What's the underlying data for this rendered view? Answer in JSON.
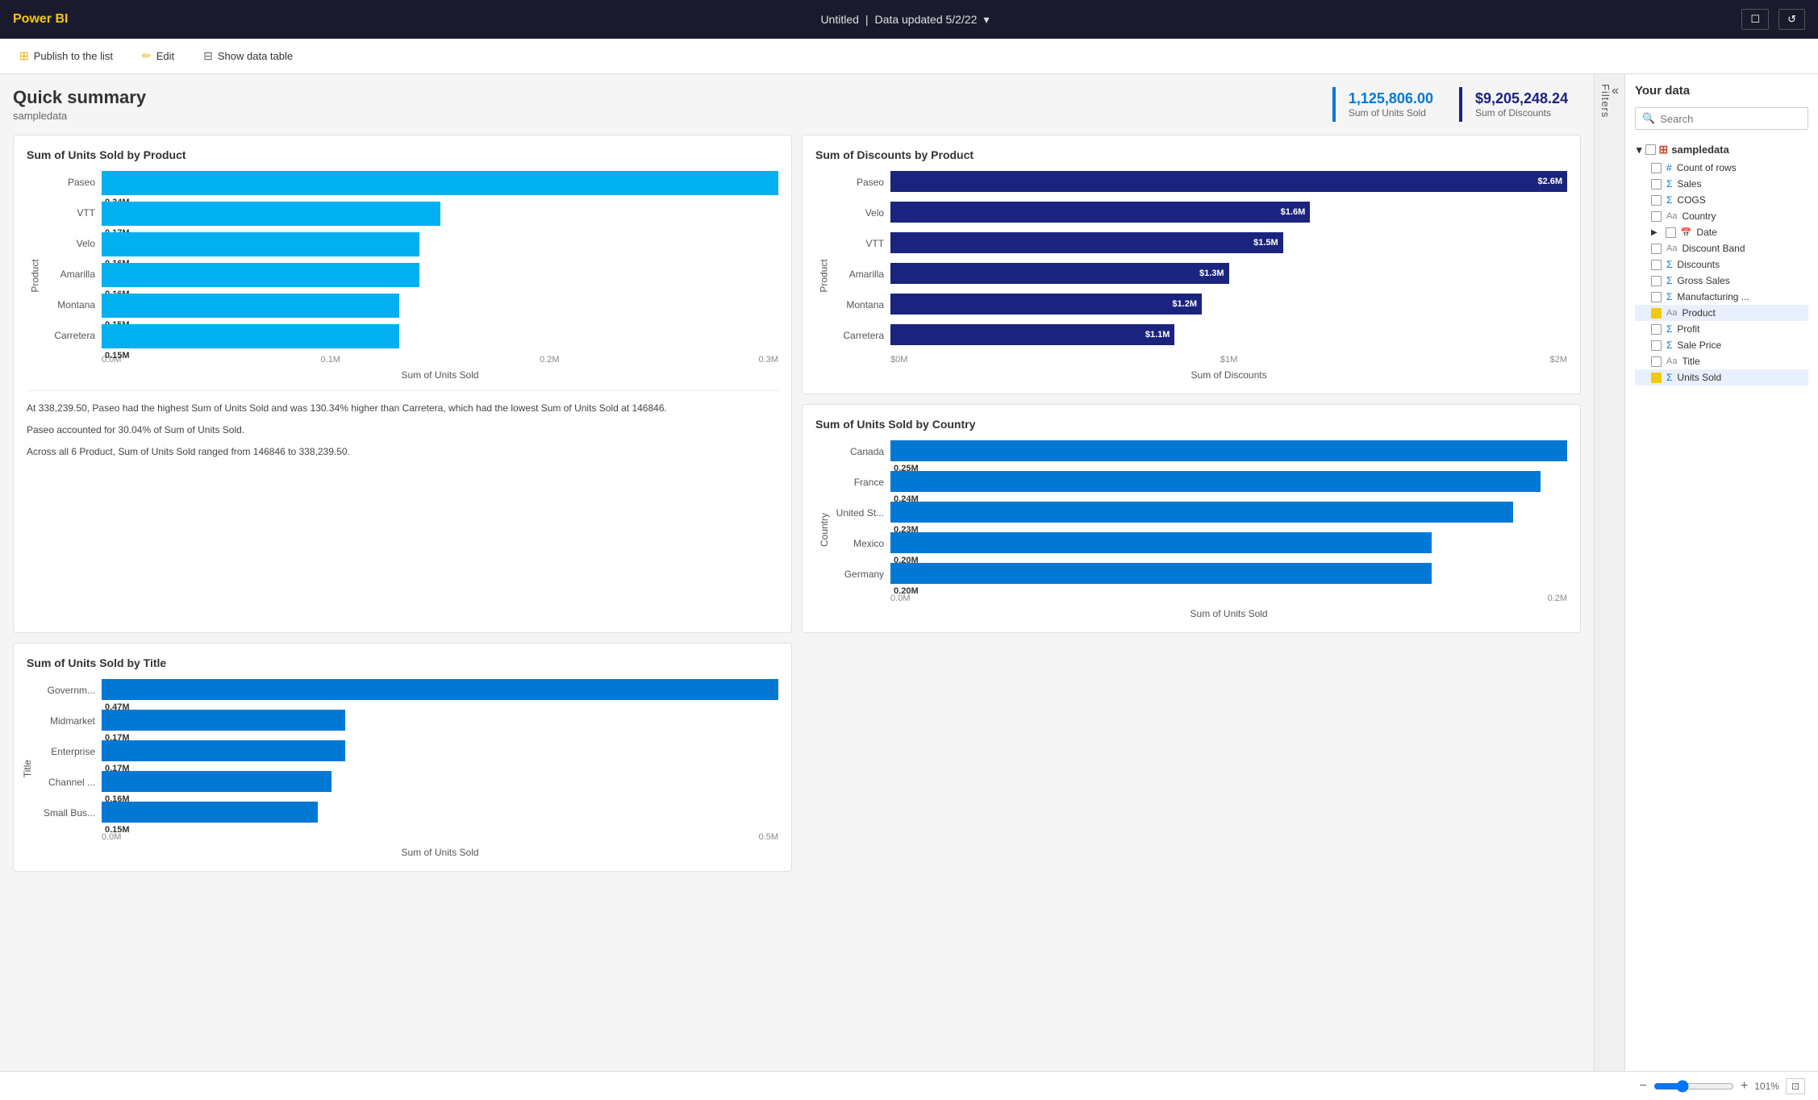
{
  "topbar": {
    "logo": "Power BI",
    "title": "Untitled",
    "separator": "|",
    "data_updated": "Data updated 5/2/22",
    "chevron": "▾",
    "btn_window": "☐",
    "btn_refresh": "↺"
  },
  "secondbar": {
    "publish": "Publish to the list",
    "edit": "Edit",
    "show_data_table": "Show data table"
  },
  "header": {
    "title": "Quick summary",
    "subtitle": "sampledata",
    "kpi1_value": "1,125,806.00",
    "kpi1_label": "Sum of Units Sold",
    "kpi2_value": "$9,205,248.24",
    "kpi2_label": "Sum of Discounts"
  },
  "chart1": {
    "title": "Sum of Units Sold by Product",
    "bars": [
      {
        "label": "Paseo",
        "value": "0.34M",
        "pct": 100
      },
      {
        "label": "VTT",
        "value": "0.17M",
        "pct": 50
      },
      {
        "label": "Velo",
        "value": "0.16M",
        "pct": 47
      },
      {
        "label": "Amarilla",
        "value": "0.16M",
        "pct": 47
      },
      {
        "label": "Montana",
        "value": "0.15M",
        "pct": 44
      },
      {
        "label": "Carretera",
        "value": "0.15M",
        "pct": 44
      }
    ],
    "x_ticks": [
      "0.0M",
      "0.1M",
      "0.2M",
      "0.3M"
    ],
    "x_label": "Sum of Units Sold",
    "y_label": "Product",
    "insight1": "At 338,239.50, Paseo had the highest Sum of Units Sold and was 130.34% higher than Carretera, which had the lowest Sum of Units Sold at 146846.",
    "insight2": "Paseo accounted for 30.04% of Sum of Units Sold.",
    "insight3": "Across all 6 Product, Sum of Units Sold ranged from 146846 to 338,239.50."
  },
  "chart2": {
    "title": "Sum of Discounts by Product",
    "bars": [
      {
        "label": "Paseo",
        "value": "$2.6M",
        "pct": 100
      },
      {
        "label": "Velo",
        "value": "$1.6M",
        "pct": 62
      },
      {
        "label": "VTT",
        "value": "$1.5M",
        "pct": 58
      },
      {
        "label": "Amarilla",
        "value": "$1.3M",
        "pct": 50
      },
      {
        "label": "Montana",
        "value": "$1.2M",
        "pct": 46
      },
      {
        "label": "Carretera",
        "value": "$1.1M",
        "pct": 42
      }
    ],
    "x_ticks": [
      "$0M",
      "$1M",
      "$2M"
    ],
    "x_label": "Sum of Discounts",
    "y_label": "Product"
  },
  "chart3": {
    "title": "Sum of Units Sold by Country",
    "bars": [
      {
        "label": "Canada",
        "value": "0.25M",
        "pct": 100
      },
      {
        "label": "France",
        "value": "0.24M",
        "pct": 96
      },
      {
        "label": "United St...",
        "value": "0.23M",
        "pct": 92
      },
      {
        "label": "Mexico",
        "value": "0.20M",
        "pct": 80
      },
      {
        "label": "Germany",
        "value": "0.20M",
        "pct": 80
      }
    ],
    "x_ticks": [
      "0.0M",
      "0.2M"
    ],
    "x_label": "Sum of Units Sold",
    "y_label": "Country"
  },
  "chart4": {
    "title": "Sum of Units Sold by Title",
    "bars": [
      {
        "label": "Governm...",
        "value": "0.47M",
        "pct": 100
      },
      {
        "label": "Midmarket",
        "value": "0.17M",
        "pct": 36
      },
      {
        "label": "Enterprise",
        "value": "0.17M",
        "pct": 36
      },
      {
        "label": "Channel ...",
        "value": "0.16M",
        "pct": 34
      },
      {
        "label": "Small Bus...",
        "value": "0.15M",
        "pct": 32
      }
    ],
    "x_ticks": [
      "0.0M",
      "0.5M"
    ],
    "x_label": "Sum of Units Sold",
    "y_label": "Title"
  },
  "rightpanel": {
    "title": "Your data",
    "search_placeholder": "Search",
    "filters_label": "Filters",
    "collapse_icon": "«",
    "table_name": "sampledata",
    "fields": [
      {
        "name": "Count of rows",
        "type": "count",
        "checked": false
      },
      {
        "name": "Sales",
        "type": "sigma",
        "checked": false
      },
      {
        "name": "COGS",
        "type": "sigma",
        "checked": false
      },
      {
        "name": "Country",
        "type": "text",
        "checked": false
      },
      {
        "name": "Date",
        "type": "calendar",
        "checked": false,
        "expandable": true
      },
      {
        "name": "Discount Band",
        "type": "text",
        "checked": false
      },
      {
        "name": "Discounts",
        "type": "sigma",
        "checked": false
      },
      {
        "name": "Gross Sales",
        "type": "sigma",
        "checked": false
      },
      {
        "name": "Manufacturing ...",
        "type": "sigma",
        "checked": false
      },
      {
        "name": "Product",
        "type": "text",
        "checked": true,
        "highlighted": true
      },
      {
        "name": "Profit",
        "type": "sigma",
        "checked": false
      },
      {
        "name": "Sale Price",
        "type": "sigma",
        "checked": false
      },
      {
        "name": "Title",
        "type": "text",
        "checked": false
      },
      {
        "name": "Units Sold",
        "type": "sigma",
        "checked": true,
        "highlighted": true
      }
    ]
  },
  "bottombar": {
    "zoom": "101%",
    "zoom_out": "−",
    "zoom_in": "+"
  }
}
